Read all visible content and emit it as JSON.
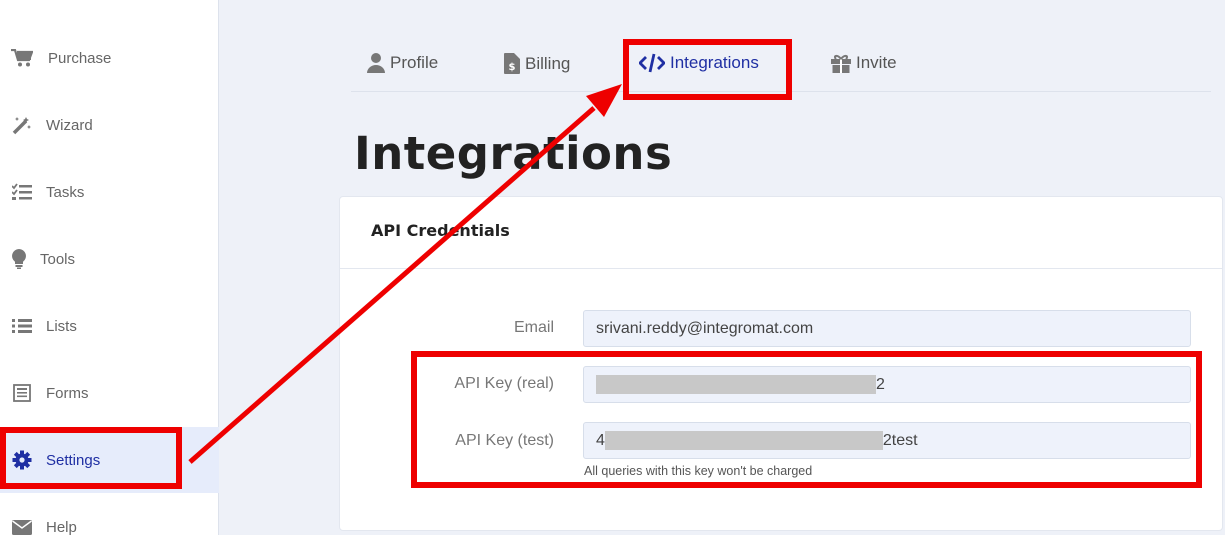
{
  "sidebar": {
    "items": [
      {
        "label": "Purchase",
        "icon": "cart-icon"
      },
      {
        "label": "Wizard",
        "icon": "magic-wand-icon"
      },
      {
        "label": "Tasks",
        "icon": "tasks-icon"
      },
      {
        "label": "Tools",
        "icon": "lightbulb-icon"
      },
      {
        "label": "Lists",
        "icon": "list-icon"
      },
      {
        "label": "Forms",
        "icon": "form-icon"
      },
      {
        "label": "Settings",
        "icon": "gear-icon"
      },
      {
        "label": "Help",
        "icon": "envelope-icon"
      }
    ],
    "active": "Settings"
  },
  "tabs": [
    {
      "label": "Profile",
      "icon": "user-icon"
    },
    {
      "label": "Billing",
      "icon": "invoice-icon"
    },
    {
      "label": "Integrations",
      "icon": "code-icon"
    },
    {
      "label": "Invite",
      "icon": "gift-icon"
    }
  ],
  "active_tab": "Integrations",
  "page": {
    "title": "Integrations"
  },
  "card": {
    "title": "API Credentials",
    "fields": [
      {
        "label": "Email",
        "value": "srivani.reddy@integromat.com"
      },
      {
        "label": "API Key (real)",
        "value_suffix": "2"
      },
      {
        "label": "API Key (test)",
        "value_prefix": "4",
        "value_suffix": "2test"
      }
    ],
    "help": "All queries with this key won't be charged"
  },
  "colors": {
    "accent": "#1f2fa3",
    "annotation": "#ee0000",
    "background": "#eef1f8"
  }
}
